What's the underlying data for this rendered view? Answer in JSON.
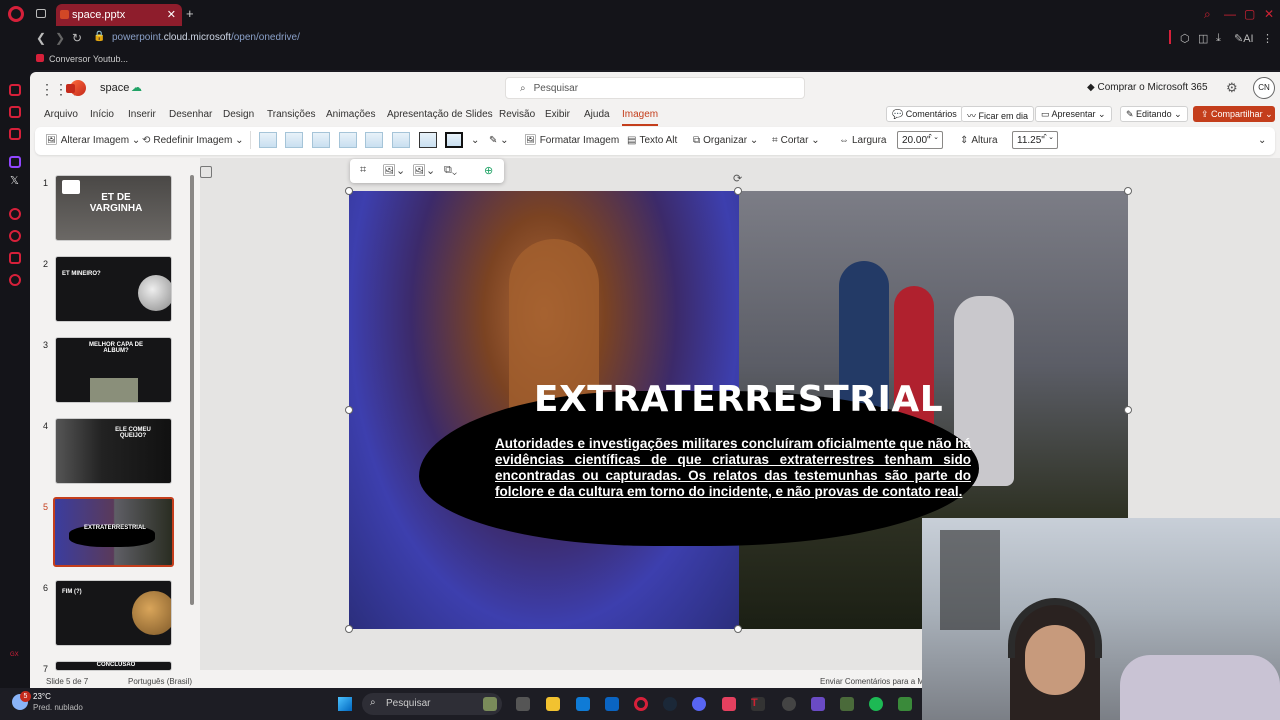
{
  "browser": {
    "tab_title": "space.pptx",
    "url_prefix": "powerpoint.",
    "url_domain": "cloud.microsoft",
    "url_path": "/open/onedrive/",
    "bookmark": "Conversor Youtub...",
    "ai_label": "AI"
  },
  "app": {
    "file_name": "space",
    "search_placeholder": "Pesquisar",
    "buy_label": "Comprar o Microsoft 365",
    "avatar_initials": "CN"
  },
  "menu": {
    "items": [
      "Arquivo",
      "Início",
      "Inserir",
      "Desenhar",
      "Design",
      "Transições",
      "Animações",
      "Apresentação de Slides",
      "Revisão",
      "Exibir",
      "Ajuda",
      "Imagem"
    ],
    "active": "Imagem",
    "comments": "Comentários",
    "catch_up": "Ficar em dia",
    "present": "Apresentar",
    "editing": "Editando",
    "share": "Compartilhar"
  },
  "ribbon": {
    "change_image": "Alterar Imagem",
    "reset_image": "Redefinir Imagem",
    "format_image": "Formatar Imagem",
    "alt_text": "Texto Alt",
    "arrange": "Organizar",
    "crop": "Cortar",
    "width_label": "Largura",
    "width_value": "20.00\"",
    "height_label": "Altura",
    "height_value": "11.25\""
  },
  "thumbnails": [
    {
      "num": "1",
      "title": "ET DE VARGINHA"
    },
    {
      "num": "2",
      "title": "ET MINEIRO?"
    },
    {
      "num": "3",
      "title": "MELHOR CAPA DE ALBUM?"
    },
    {
      "num": "4",
      "title": "ELE COMEU QUEIJO?"
    },
    {
      "num": "5",
      "title": "EXTRATERRESTRIAL"
    },
    {
      "num": "6",
      "title": "FIM (?)"
    },
    {
      "num": "7",
      "title": "CONCLUSÃO"
    }
  ],
  "slide": {
    "title": "EXTRATERRESTRIAL",
    "body": "Autoridades e investigações militares concluíram oficialmente que não há evidências científicas de que criaturas extraterrestres tenham sido encontradas ou capturadas. Os relatos das testemunhas são parte do folclore e da cultura em torno do incidente, e não provas de contato real."
  },
  "status": {
    "slide_info": "Slide 5 de 7",
    "language": "Português (Brasil)",
    "feedback": "Enviar Comentários para a M"
  },
  "taskbar": {
    "temp": "23°C",
    "weather": "Pred. nublado",
    "badge": "5",
    "search": "Pesquisar"
  }
}
